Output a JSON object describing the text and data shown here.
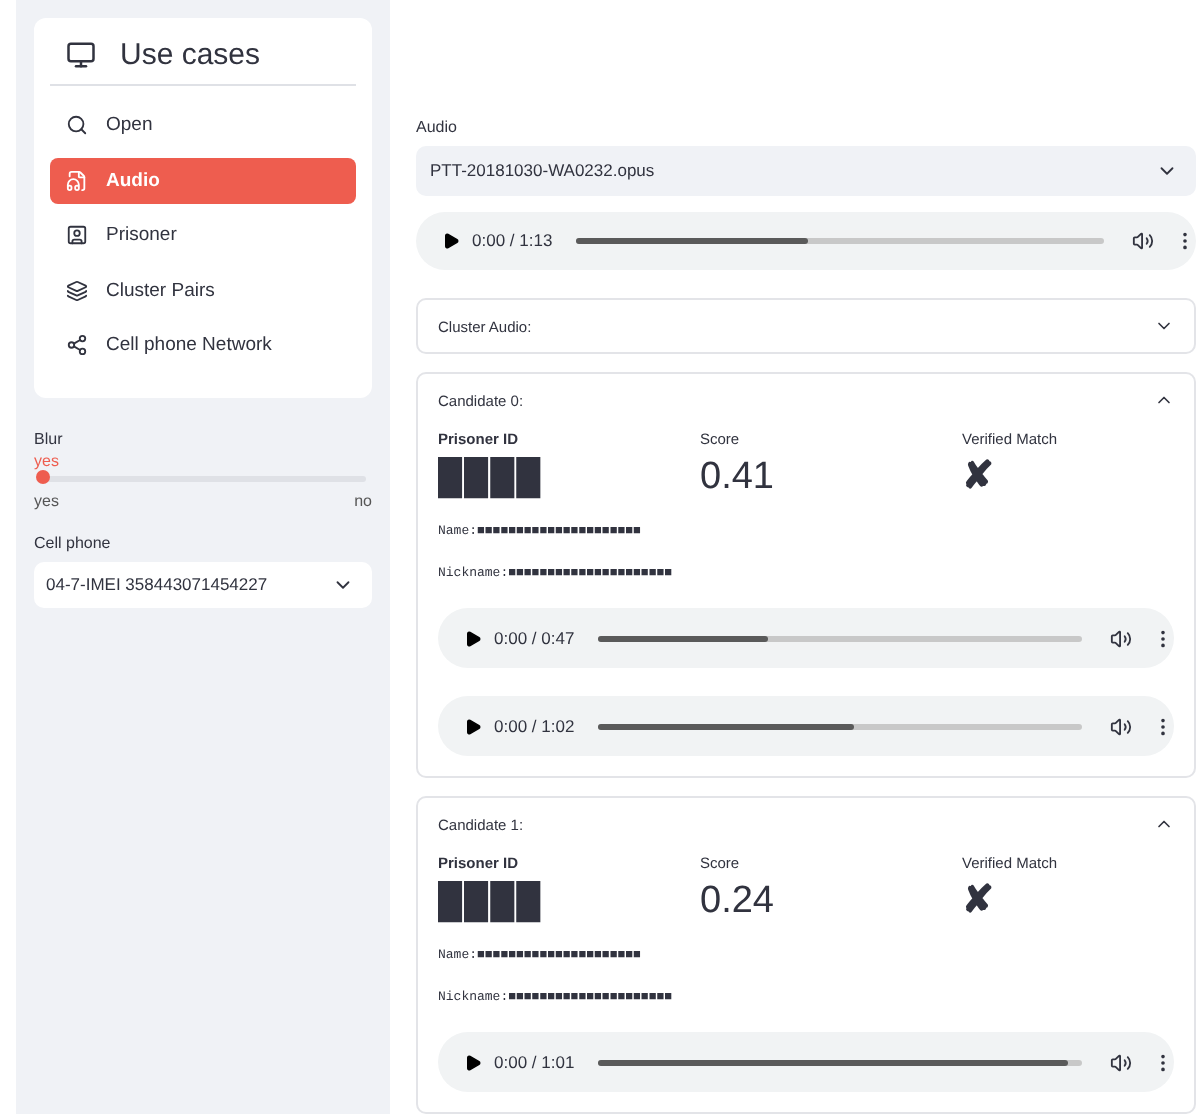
{
  "sidebar": {
    "menu": {
      "title": "Use cases",
      "items": [
        {
          "label": "Open",
          "selected": false
        },
        {
          "label": "Audio",
          "selected": true
        },
        {
          "label": "Prisoner",
          "selected": false
        },
        {
          "label": "Cluster Pairs",
          "selected": false
        },
        {
          "label": "Cell phone Network",
          "selected": false
        }
      ]
    },
    "blur": {
      "label": "Blur",
      "value": "yes",
      "level": 0,
      "min_label": "yes",
      "max_label": "no"
    },
    "cell_phone": {
      "label": "Cell phone",
      "value": "04-7-IMEI 358443071454227"
    }
  },
  "main": {
    "audio": {
      "label": "Audio",
      "value": "PTT-20181030-WA0232.opus"
    },
    "player": {
      "time": "0:00 / 1:13",
      "level": 0.44
    },
    "expanders": [
      {
        "title": "Cluster Audio:",
        "expanded": false
      },
      {
        "title": "Candidate 0:",
        "expanded": true,
        "prisoner_id_label": "Prisoner ID",
        "prisoner_id": "████",
        "score_label": "Score",
        "score": "0.41",
        "verified_label": "Verified Match",
        "verified": "✘",
        "name": "Name:■■■■■■■■■■■■■■■■■■■■■",
        "nickname": "Nickname:■■■■■■■■■■■■■■■■■■■■■",
        "players": [
          {
            "time": "0:00 / 0:47",
            "level": 0.35
          },
          {
            "time": "0:00 / 1:02",
            "level": 0.53
          }
        ]
      },
      {
        "title": "Candidate 1:",
        "expanded": true,
        "prisoner_id_label": "Prisoner ID",
        "prisoner_id": "████",
        "score_label": "Score",
        "score": "0.24",
        "verified_label": "Verified Match",
        "verified": "✘",
        "name": "Name:■■■■■■■■■■■■■■■■■■■■■",
        "nickname": "Nickname:■■■■■■■■■■■■■■■■■■■■■",
        "players": [
          {
            "time": "0:00 / 1:01",
            "level": 0.97
          }
        ]
      }
    ]
  }
}
